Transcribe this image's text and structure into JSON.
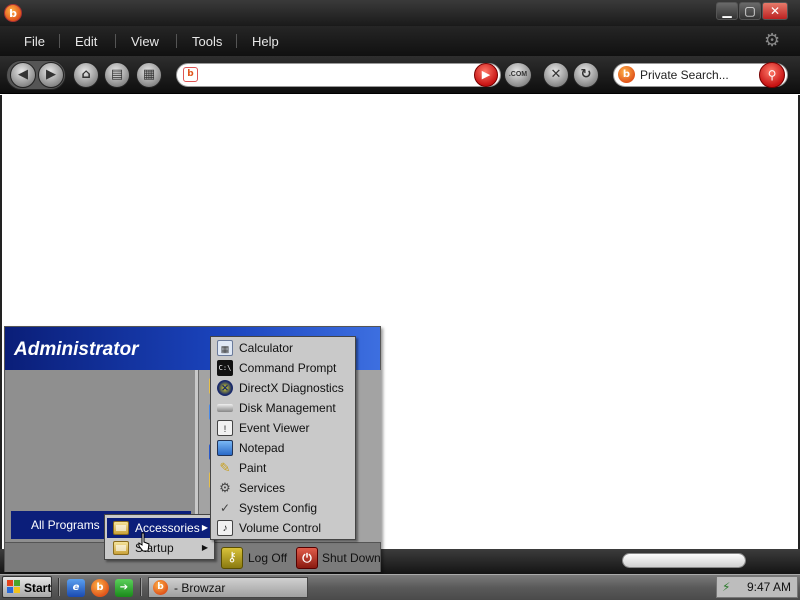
{
  "window": {
    "logo_glyph": "b",
    "controls": {
      "minimize": "▁",
      "maximize": "▢",
      "close": "✕"
    }
  },
  "menubar": {
    "items": [
      "File",
      "Edit",
      "View",
      "Tools",
      "Help"
    ]
  },
  "toolbar": {
    "address_value": "",
    "address_icon_glyph": "b",
    "com_button_label": ".COM",
    "search_placeholder": "Private Search...",
    "search_logo_glyph": "b"
  },
  "status": {
    "progress": 1.0
  },
  "start_menu": {
    "user_name": "Administrator",
    "all_programs_label": "All Programs",
    "programs_submenu": [
      {
        "label": "Accessories",
        "active": true,
        "has_submenu": true
      },
      {
        "label": "Startup",
        "active": false,
        "has_submenu": true
      }
    ],
    "accessories": [
      {
        "label": "Calculator",
        "icon": "calculator-icon"
      },
      {
        "label": "Command Prompt",
        "icon": "command-prompt-icon"
      },
      {
        "label": "DirectX Diagnostics",
        "icon": "directx-icon"
      },
      {
        "label": "Disk Management",
        "icon": "disk-icon"
      },
      {
        "label": "Event Viewer",
        "icon": "event-viewer-icon"
      },
      {
        "label": "Notepad",
        "icon": "notepad-icon"
      },
      {
        "label": "Paint",
        "icon": "paint-icon"
      },
      {
        "label": "Services",
        "icon": "services-icon"
      },
      {
        "label": "System Config",
        "icon": "system-config-icon"
      },
      {
        "label": "Volume Control",
        "icon": "volume-icon"
      }
    ],
    "log_off_label": "Log Off",
    "shut_down_label": "Shut Down"
  },
  "taskbar": {
    "start_label": "Start",
    "task_label": "- Browzar",
    "clock": "9:47 AM"
  },
  "colors": {
    "header_blue": "#0b1e7a",
    "menu_gray": "#c9c9c9",
    "browser_chrome": "#1a1a1a",
    "accent_orange": "#e0551b",
    "accent_red": "#c81414"
  }
}
